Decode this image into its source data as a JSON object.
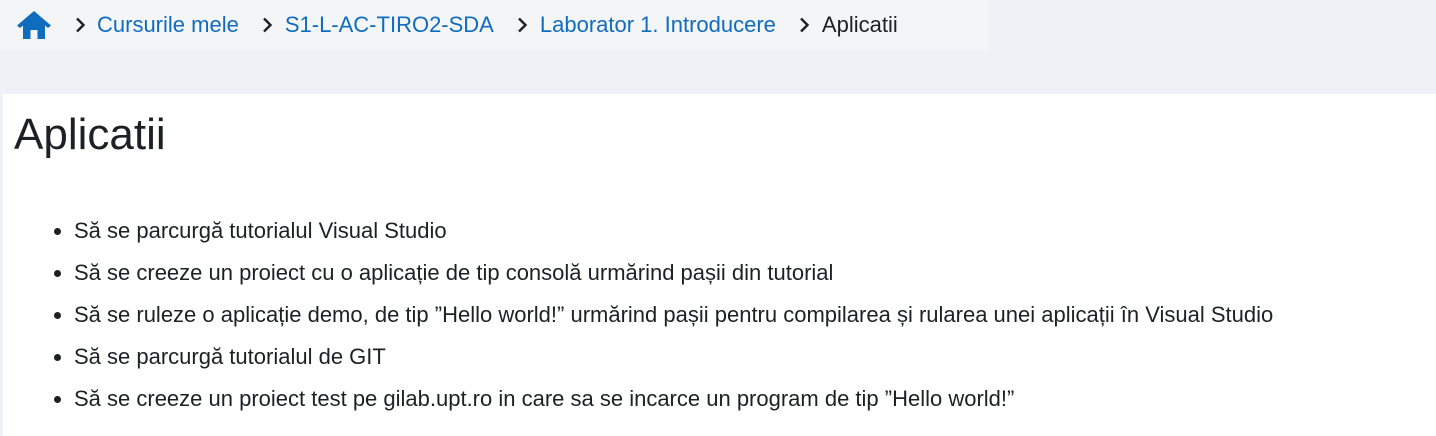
{
  "breadcrumb": {
    "items": [
      {
        "label": "Cursurile mele"
      },
      {
        "label": "S1-L-AC-TIRO2-SDA"
      },
      {
        "label": "Laborator 1. Introducere"
      }
    ],
    "current": "Aplicatii"
  },
  "main": {
    "title": "Aplicatii",
    "tasks": [
      "Să se parcurgă tutorialul Visual Studio",
      "Să se creeze un proiect cu o aplicație de tip consolă urmărind pașii din tutorial",
      "Să se ruleze o aplicație demo, de tip ”Hello world!” urmărind pașii pentru compilarea și rularea unei aplicații în Visual Studio",
      "Să se parcurgă tutorialul de GIT",
      "Să se creeze un proiect test pe gilab.upt.ro in care sa se incarce un program de tip ”Hello world!”"
    ]
  },
  "colors": {
    "link": "#0f6cbf",
    "text": "#1d2125",
    "page_bg": "#eef1f5",
    "breadcrumb_bg": "#f4f5f6",
    "content_bg": "#ffffff"
  },
  "icons": {
    "home": "home-icon",
    "separator": "chevron-right-icon"
  }
}
